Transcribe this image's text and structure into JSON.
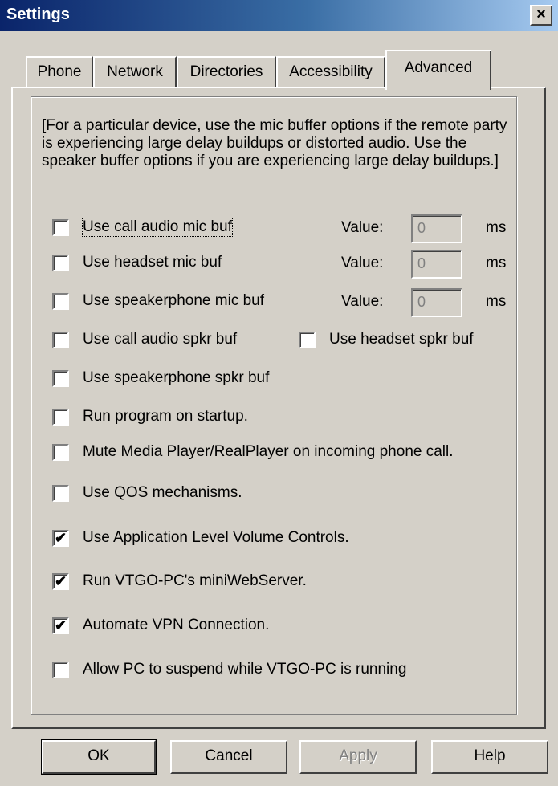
{
  "window": {
    "title": "Settings",
    "close_symbol": "×"
  },
  "tabs": [
    {
      "label": "Phone",
      "active": false
    },
    {
      "label": "Network",
      "active": false
    },
    {
      "label": "Directories",
      "active": false
    },
    {
      "label": "Accessibility",
      "active": false
    },
    {
      "label": "Advanced",
      "active": true
    }
  ],
  "description": "[For a particular device, use the mic buffer options if the remote party is experiencing large delay buildups or distorted audio.  Use the speaker buffer options if you are experiencing large delay buildups.]",
  "buffers": {
    "value_label": "Value:",
    "unit": "ms",
    "call_audio_mic": {
      "label": "Use call audio mic buf",
      "checked": false,
      "value": "0"
    },
    "headset_mic": {
      "label": "Use headset mic buf",
      "checked": false,
      "value": "0"
    },
    "speakerphone_mic": {
      "label": "Use speakerphone mic buf",
      "checked": false,
      "value": "0"
    },
    "call_audio_spkr": {
      "label": "Use call audio spkr buf",
      "checked": false
    },
    "headset_spkr": {
      "label": "Use headset spkr buf",
      "checked": false
    },
    "speakerphone_spkr": {
      "label": "Use speakerphone spkr buf",
      "checked": false
    }
  },
  "options": {
    "run_on_startup": {
      "label": "Run program on startup.",
      "checked": false
    },
    "mute_media_player": {
      "label": "Mute Media Player/RealPlayer on incoming phone call.",
      "checked": false
    },
    "use_qos": {
      "label": "Use QOS mechanisms.",
      "checked": false
    },
    "app_volume_controls": {
      "label": "Use Application Level Volume Controls.",
      "checked": true
    },
    "mini_web_server": {
      "label": "Run VTGO-PC's miniWebServer.",
      "checked": true
    },
    "automate_vpn": {
      "label": "Automate VPN Connection.",
      "checked": true
    },
    "allow_suspend": {
      "label": "Allow PC to suspend while VTGO-PC is running",
      "checked": false
    }
  },
  "buttons": {
    "ok": "OK",
    "cancel": "Cancel",
    "apply": "Apply",
    "help": "Help"
  }
}
